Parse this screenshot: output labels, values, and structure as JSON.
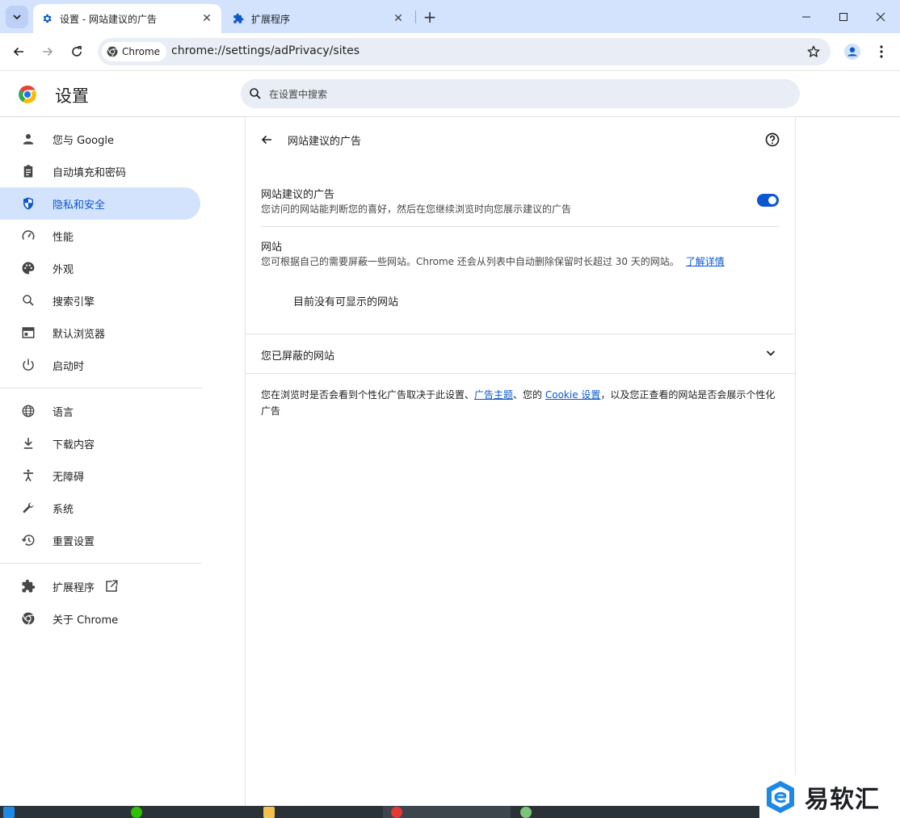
{
  "browser": {
    "tabs": [
      {
        "title": "设置 - 网站建议的广告",
        "icon": "gear-icon",
        "active": true,
        "close": "✕"
      },
      {
        "title": "扩展程序",
        "icon": "puzzle-icon",
        "active": false,
        "close": "✕"
      }
    ],
    "new_tab": "+",
    "site_chip": "Chrome",
    "url": "chrome://settings/adPrivacy/sites"
  },
  "header": {
    "title": "设置",
    "search_placeholder": "在设置中搜索"
  },
  "sidebar": {
    "items": [
      {
        "label": "您与 Google",
        "icon": "person-icon"
      },
      {
        "label": "自动填充和密码",
        "icon": "clipboard-icon"
      },
      {
        "label": "隐私和安全",
        "icon": "shield-icon",
        "selected": true
      },
      {
        "label": "性能",
        "icon": "gauge-icon"
      },
      {
        "label": "外观",
        "icon": "palette-icon"
      },
      {
        "label": "搜索引擎",
        "icon": "search-icon"
      },
      {
        "label": "默认浏览器",
        "icon": "browser-window-icon"
      },
      {
        "label": "启动时",
        "icon": "power-icon"
      },
      {
        "label": "语言",
        "icon": "globe-icon"
      },
      {
        "label": "下载内容",
        "icon": "download-icon"
      },
      {
        "label": "无障碍",
        "icon": "accessibility-icon"
      },
      {
        "label": "系统",
        "icon": "wrench-icon"
      },
      {
        "label": "重置设置",
        "icon": "history-icon"
      },
      {
        "label": "扩展程序",
        "icon": "puzzle-icon",
        "external": true
      },
      {
        "label": "关于 Chrome",
        "icon": "chrome-icon"
      }
    ]
  },
  "page": {
    "title": "网站建议的广告",
    "toggle_row": {
      "title": "网站建议的广告",
      "subtitle": "您访问的网站能判断您的喜好，然后在您继续浏览时向您展示建议的广告",
      "enabled": true
    },
    "sites_section": {
      "title": "网站",
      "subtitle": "您可根据自己的需要屏蔽一些网站。Chrome 还会从列表中自动删除保留时长超过 30 天的网站。",
      "learn_more": "了解详情",
      "empty": "目前没有可显示的网站"
    },
    "blocked_section": {
      "title": "您已屏蔽的网站"
    },
    "footnote": {
      "part1": "您在浏览时是否会看到个性化广告取决于此设置、",
      "link1": "广告主题",
      "part2": "、您的 ",
      "link2": "Cookie 设置",
      "part3": "，以及您正查看的网站是否会展示个性化广告"
    }
  },
  "watermark": {
    "text": "易软汇"
  },
  "colors": {
    "accent": "#0b57d0",
    "selected_bg": "#d3e3fd",
    "tabstrip": "#d3e3fd",
    "omnibox": "#e9eef6"
  }
}
